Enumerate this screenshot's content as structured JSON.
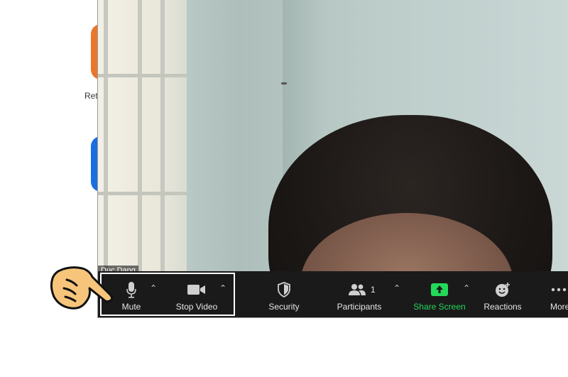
{
  "background_app": {
    "label": "Ret"
  },
  "meeting": {
    "participant_name": "Duc Dang"
  },
  "toolbar": {
    "mute_label": "Mute",
    "stop_video_label": "Stop Video",
    "security_label": "Security",
    "participants_label": "Participants",
    "participants_count": "1",
    "share_screen_label": "Share Screen",
    "reactions_label": "Reactions",
    "more_label": "More",
    "caret_glyph": "⌃"
  },
  "icons": {
    "mute": "microphone-icon",
    "video": "video-camera-icon",
    "security": "shield-icon",
    "participants": "people-icon",
    "share": "share-screen-icon",
    "reactions": "smiley-icon",
    "more": "more-dots-icon",
    "pointer": "pointing-hand-icon"
  },
  "colors": {
    "toolbar_bg": "#1a1a1a",
    "share_green": "#23d959",
    "highlight_border": "#ffffff"
  }
}
